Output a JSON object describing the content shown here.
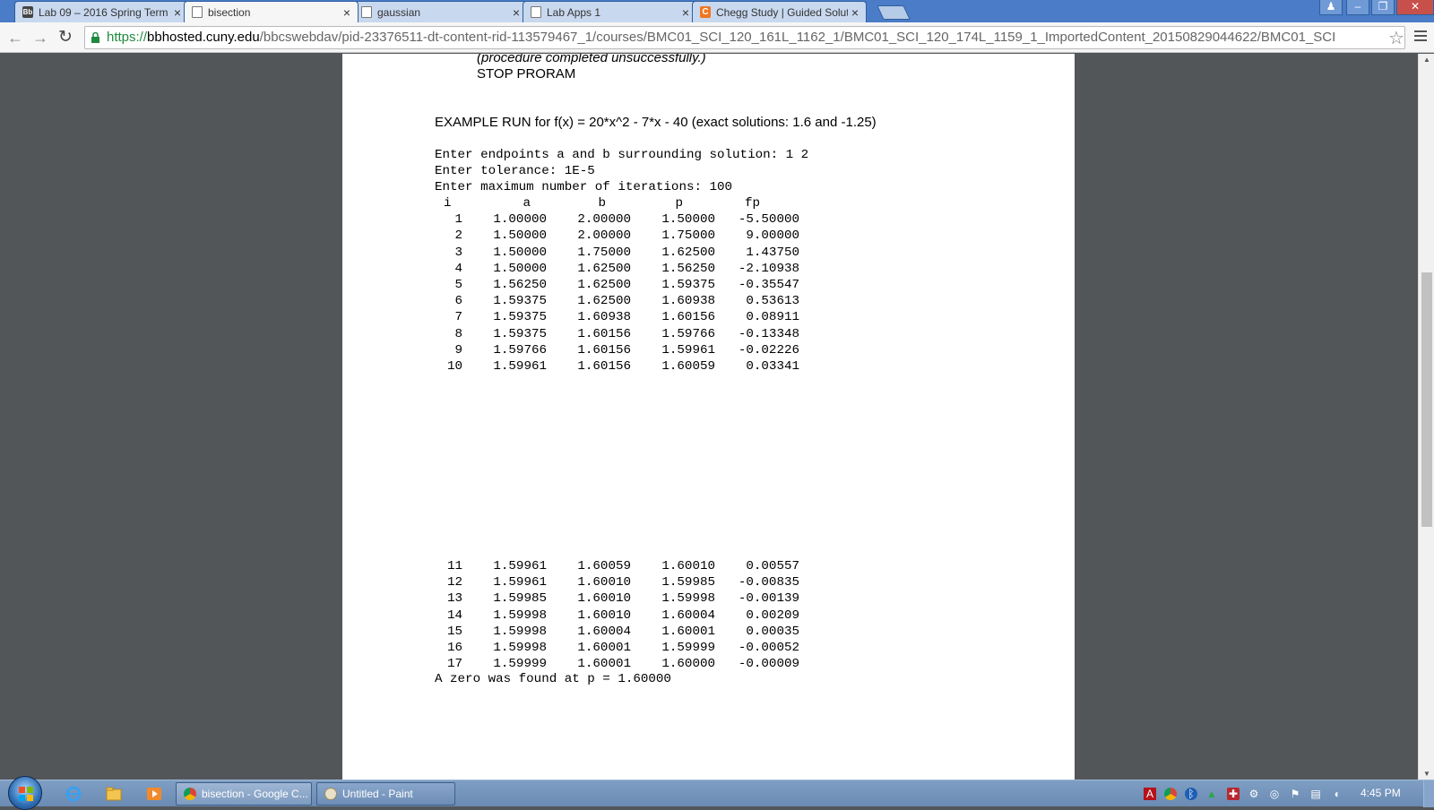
{
  "browser": {
    "tabs": [
      {
        "title": "Lab 09 – 2016 Spring Term",
        "favicon": "blackboard-icon"
      },
      {
        "title": "bisection",
        "favicon": "document-icon",
        "active": true
      },
      {
        "title": "gaussian",
        "favicon": "document-icon"
      },
      {
        "title": "Lab Apps 1",
        "favicon": "document-icon"
      },
      {
        "title": "Chegg Study | Guided Solutions",
        "favicon": "chegg-icon"
      }
    ],
    "close_glyph": "×",
    "window_controls": {
      "user": "♟",
      "minimize": "–",
      "restore": "❐",
      "close": "✕"
    },
    "url": {
      "scheme": "https://",
      "host": "bbhosted.cuny.edu",
      "path": "/bbcswebdav/pid-23376511-dt-content-rid-113579467_1/courses/BMC01_SCI_120_161L_1162_1/BMC01_SCI_120_174L_1159_1_ImportedContent_20150829044622/BMC01_SCI"
    }
  },
  "document": {
    "page1": {
      "procedure_note": "(procedure completed unsuccessfully.)",
      "stop_line": "STOP PRORAM",
      "example_heading": "EXAMPLE RUN for f(x) = 20*x^2 - 7*x - 40 (exact solutions: 1.6 and -1.25)",
      "prompts": [
        "Enter endpoints a and b surrounding solution: 1 2",
        "Enter tolerance: 1E-5",
        "Enter maximum number of iterations: 100"
      ],
      "columns": [
        "i",
        "a",
        "b",
        "p",
        "fp"
      ],
      "rows": [
        [
          "1",
          "1.00000",
          "2.00000",
          "1.50000",
          "-5.50000"
        ],
        [
          "2",
          "1.50000",
          "2.00000",
          "1.75000",
          "9.00000"
        ],
        [
          "3",
          "1.50000",
          "1.75000",
          "1.62500",
          "1.43750"
        ],
        [
          "4",
          "1.50000",
          "1.62500",
          "1.56250",
          "-2.10938"
        ],
        [
          "5",
          "1.56250",
          "1.62500",
          "1.59375",
          "-0.35547"
        ],
        [
          "6",
          "1.59375",
          "1.62500",
          "1.60938",
          "0.53613"
        ],
        [
          "7",
          "1.59375",
          "1.60938",
          "1.60156",
          "0.08911"
        ],
        [
          "8",
          "1.59375",
          "1.60156",
          "1.59766",
          "-0.13348"
        ],
        [
          "9",
          "1.59766",
          "1.60156",
          "1.59961",
          "-0.02226"
        ],
        [
          "10",
          "1.59961",
          "1.60156",
          "1.60059",
          "0.03341"
        ]
      ]
    },
    "page2": {
      "rows": [
        [
          "11",
          "1.59961",
          "1.60059",
          "1.60010",
          "0.00557"
        ],
        [
          "12",
          "1.59961",
          "1.60010",
          "1.59985",
          "-0.00835"
        ],
        [
          "13",
          "1.59985",
          "1.60010",
          "1.59998",
          "-0.00139"
        ],
        [
          "14",
          "1.59998",
          "1.60010",
          "1.60004",
          "0.00209"
        ],
        [
          "15",
          "1.59998",
          "1.60004",
          "1.60001",
          "0.00035"
        ],
        [
          "16",
          "1.59998",
          "1.60001",
          "1.59999",
          "-0.00052"
        ],
        [
          "17",
          "1.59999",
          "1.60001",
          "1.60000",
          "-0.00009"
        ]
      ],
      "result": "A zero was found at p = 1.60000"
    }
  },
  "taskbar": {
    "items": [
      {
        "label": "bisection - Google C...",
        "icon": "chrome-icon"
      },
      {
        "label": "Untitled - Paint",
        "icon": "paint-icon"
      }
    ],
    "clock": "4:45 PM"
  },
  "colors": {
    "tab_strip": "#4a7cc7",
    "url_https": "#1f8a3f",
    "page_bg": "#525659"
  }
}
